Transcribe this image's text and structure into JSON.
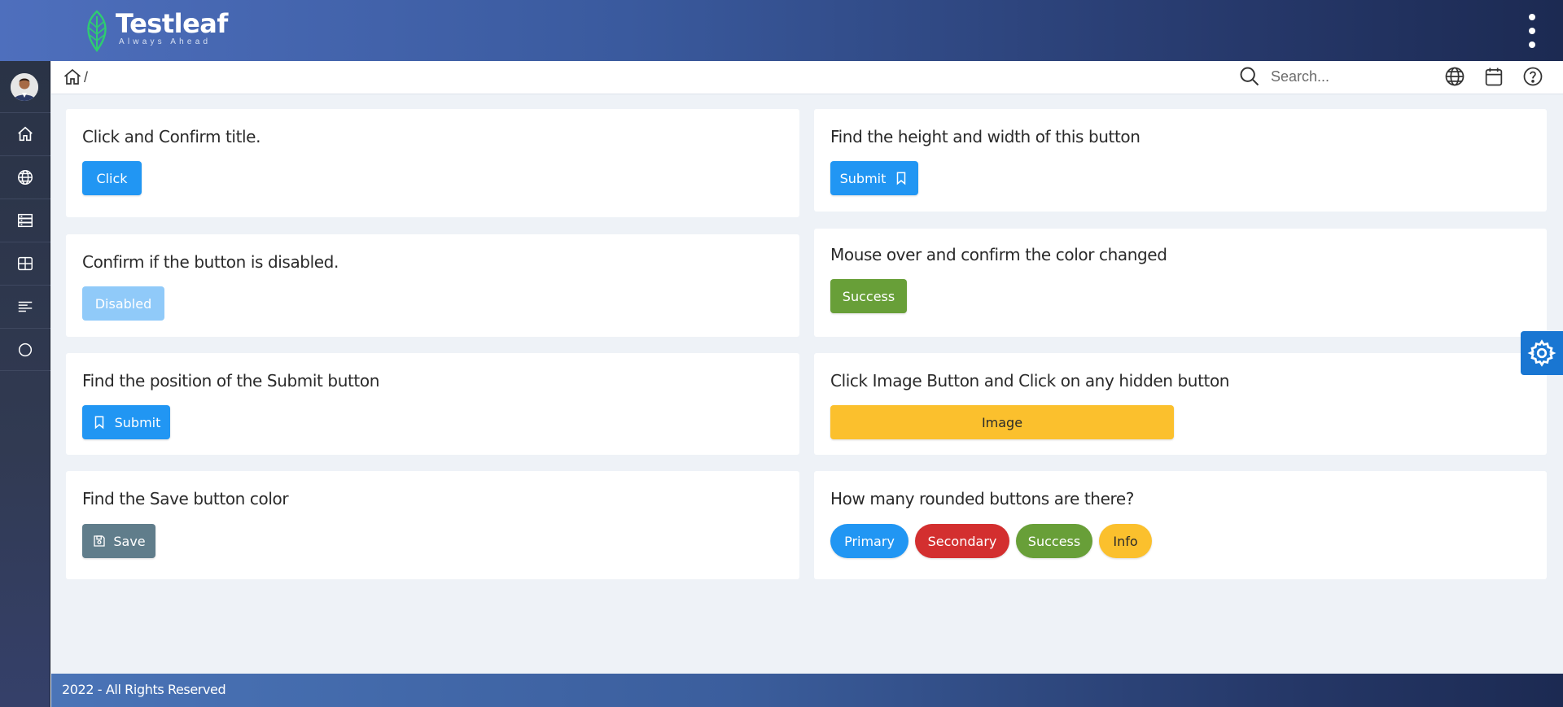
{
  "header": {
    "brand_name": "Testleaf",
    "brand_tagline": "Always Ahead",
    "menu_icon": "kebab-menu-icon"
  },
  "sidebar": {
    "avatar_icon": "user-avatar",
    "items": [
      {
        "icon": "home-icon"
      },
      {
        "icon": "globe-icon"
      },
      {
        "icon": "server-icon"
      },
      {
        "icon": "grid-icon"
      },
      {
        "icon": "align-left-icon"
      },
      {
        "icon": "circle-icon"
      }
    ]
  },
  "topbar": {
    "breadcrumb_separator": "/",
    "search_placeholder": "Search...",
    "search_value": "",
    "tools": [
      "globe-icon",
      "calendar-icon",
      "help-icon"
    ]
  },
  "cards": {
    "click_confirm": {
      "title": "Click and Confirm title.",
      "button": "Click"
    },
    "height_width": {
      "title": "Find the height and width of this button",
      "button": "Submit"
    },
    "disabled": {
      "title": "Confirm if the button is disabled.",
      "button": "Disabled"
    },
    "mouse_over": {
      "title": "Mouse over and confirm the color changed",
      "button": "Success"
    },
    "position": {
      "title": "Find the position of the Submit button",
      "button": "Submit"
    },
    "image_button": {
      "title": "Click Image Button and Click on any hidden button",
      "button": "Image"
    },
    "save_color": {
      "title": "Find the Save button color",
      "button": "Save"
    },
    "rounded": {
      "title": "How many rounded buttons are there?",
      "buttons": [
        "Primary",
        "Secondary",
        "Success",
        "Info"
      ]
    }
  },
  "footer": {
    "text": "2022 - All Rights Reserved"
  },
  "colors": {
    "primary": "#2196f3",
    "success": "#689f38",
    "secondary": "#d32f2f",
    "info": "#fbc02d",
    "save": "#607d8b",
    "disabled": "#90caf9",
    "settings_fab": "#1976d2"
  }
}
